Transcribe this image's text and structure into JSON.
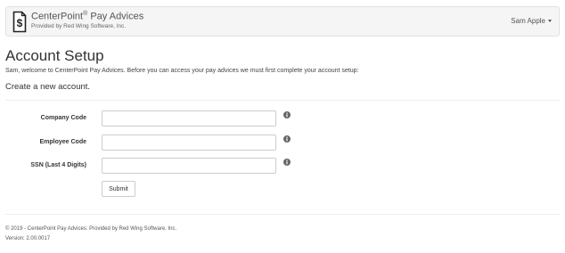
{
  "header": {
    "brand_name": "CenterPoint",
    "brand_reg": "®",
    "brand_product": " Pay Advices",
    "brand_subtitle": "Provided by Red Wing Software, Inc.",
    "logo_icon": "dollar-document-icon",
    "user_name": "Sam Apple"
  },
  "page": {
    "title": "Account Setup",
    "welcome": "Sam, welcome to CenterPoint Pay Advices. Before you can access your pay advices we must first complete your account setup:",
    "subtitle": "Create a new account."
  },
  "form": {
    "fields": [
      {
        "label": "Company Code",
        "value": "",
        "icon": "info-icon"
      },
      {
        "label": "Employee Code",
        "value": "",
        "icon": "info-icon"
      },
      {
        "label": "SSN (Last 4 Digits)",
        "value": "",
        "icon": "info-icon"
      }
    ],
    "submit_label": "Submit"
  },
  "footer": {
    "copyright": "© 2019 - CenterPoint Pay Advices: Provided by Red Wing Software, Inc.",
    "version": "Version: 2.00.0017"
  }
}
